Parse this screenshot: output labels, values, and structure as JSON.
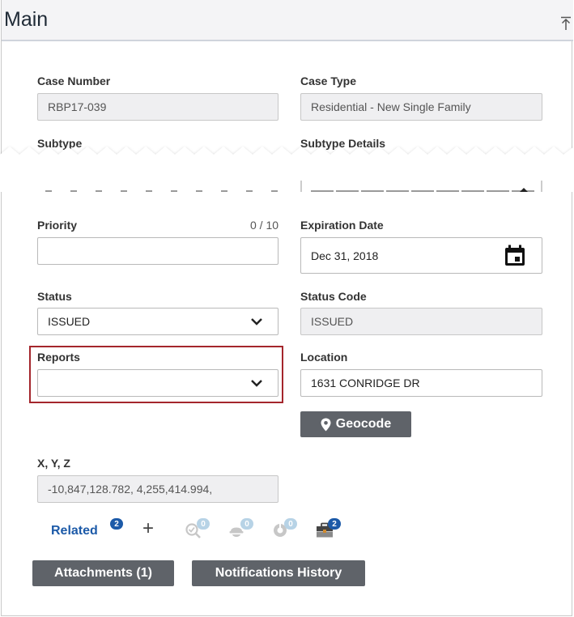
{
  "header": {
    "title": "Main"
  },
  "fields": {
    "case_number": {
      "label": "Case Number",
      "value": "RBP17-039"
    },
    "case_type": {
      "label": "Case Type",
      "value": "Residential - New Single Family"
    },
    "subtype": {
      "label": "Subtype"
    },
    "subtype_details": {
      "label": "Subtype Details"
    },
    "priority": {
      "label": "Priority",
      "counter": "0 / 10",
      "value": ""
    },
    "expiration_date": {
      "label": "Expiration Date",
      "value": "Dec 31, 2018"
    },
    "status": {
      "label": "Status",
      "value": "ISSUED"
    },
    "status_code": {
      "label": "Status Code",
      "value": "ISSUED"
    },
    "reports": {
      "label": "Reports",
      "value": ""
    },
    "location": {
      "label": "Location",
      "value": "1631 CONRIDGE DR"
    },
    "xyz": {
      "label": "X, Y, Z",
      "value": "-10,847,128.782, 4,255,414.994,"
    }
  },
  "geocode_label": "Geocode",
  "related": {
    "label": "Related",
    "count": "2",
    "plus": "+",
    "badges": [
      "0",
      "0",
      "0",
      "2"
    ]
  },
  "buttons": {
    "attachments": "Attachments (1)",
    "notifications_history": "Notifications History"
  },
  "colors": {
    "accent": "#1c5aa8",
    "button_bg": "#5f6369",
    "highlight": "#a4262c",
    "readonly_bg": "#efeff1"
  }
}
